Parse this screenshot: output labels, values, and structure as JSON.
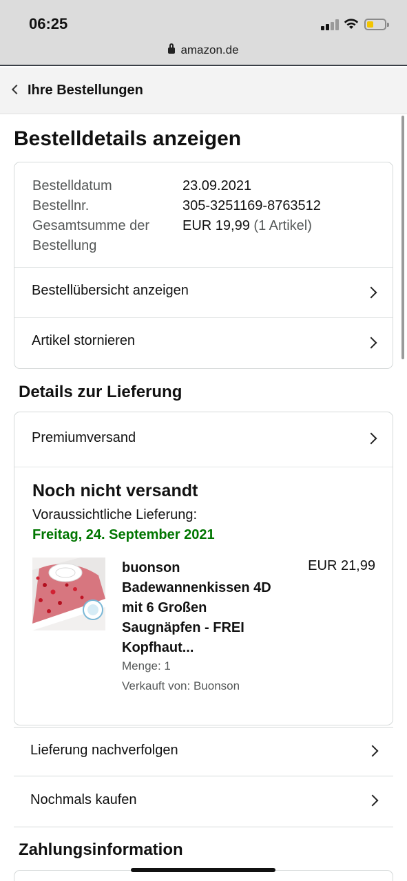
{
  "status_bar": {
    "time": "06:25",
    "url": "amazon.de"
  },
  "nav": {
    "back_label": "Ihre Bestellungen"
  },
  "page_title": "Bestelldetails anzeigen",
  "order_summary": {
    "date_label": "Bestelldatum",
    "date_value": "23.09.2021",
    "number_label": "Bestellnr.",
    "number_value": "305-3251169-8763512",
    "total_label_line1": "Gesamtsumme der",
    "total_label_line2": "Bestellung",
    "total_value": "EUR 19,99",
    "total_count": "(1 Artikel)",
    "links": [
      "Bestellübersicht anzeigen",
      "Artikel stornieren"
    ]
  },
  "delivery": {
    "heading": "Details zur Lieferung",
    "shipping_method": "Premiumversand",
    "status": "Noch nicht versandt",
    "estimate_label": "Voraussichtliche Lieferung:",
    "estimate_date": "Freitag, 24. September 2021",
    "item": {
      "title_lines": [
        "buonson",
        "Badewannenkissen 4D",
        "mit 6 Großen",
        "Saugnäpfen - FREI",
        "Kopfhaut..."
      ],
      "price": "EUR 21,99",
      "quantity": "Menge: 1",
      "seller": "Verkauft von: Buonson"
    },
    "actions": [
      "Lieferung nachverfolgen",
      "Nochmals kaufen"
    ]
  },
  "payment": {
    "heading": "Zahlungsinformation"
  },
  "colors": {
    "delivery_green": "#007600",
    "border": "#d5d9d9",
    "muted_text": "#565959"
  }
}
